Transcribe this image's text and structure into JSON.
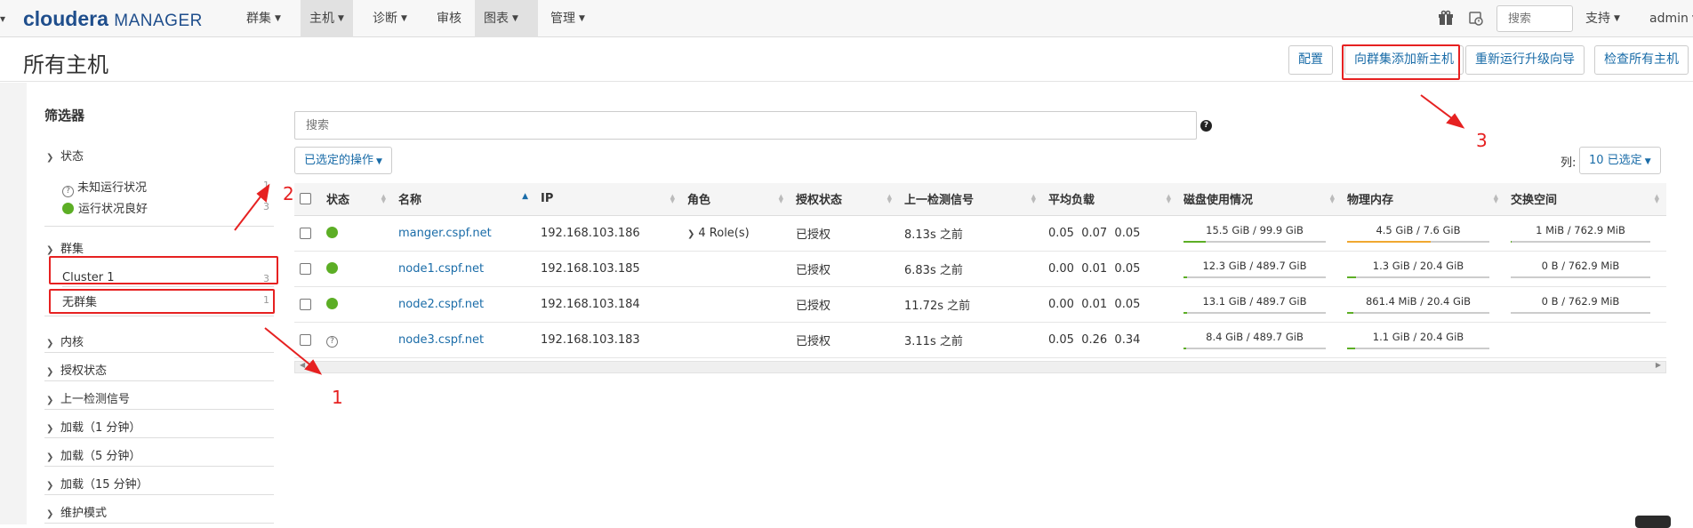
{
  "nav": {
    "edge_mark": "▾",
    "logo_brand": "cloudera",
    "logo_product": "MANAGER",
    "items": [
      {
        "label": "群集",
        "caret": true,
        "active": false
      },
      {
        "label": "主机",
        "caret": true,
        "active": true
      },
      {
        "label": "诊断",
        "caret": true,
        "active": false
      },
      {
        "label": "审核",
        "caret": false,
        "active": false
      },
      {
        "label": "图表",
        "caret": true,
        "active": true
      },
      {
        "label": "管理",
        "caret": true,
        "active": false
      }
    ],
    "gift_icon": "gift-icon",
    "activity_icon": "activity-icon",
    "search_placeholder": "搜索",
    "support_label": "支持",
    "user_label": "admin"
  },
  "header": {
    "title": "所有主机",
    "buttons": {
      "configure": "配置",
      "add_hosts": "向群集添加新主机",
      "rerun_upgrade": "重新运行升级向导",
      "inspect_all": "检查所有主机"
    }
  },
  "filters": {
    "title": "筛选器",
    "status_section": "状态",
    "status_items": [
      {
        "label": "未知运行状况",
        "count": "1",
        "icon": "unknown-health-icon"
      },
      {
        "label": "运行状况良好",
        "count": "3",
        "icon": "good-health-icon"
      }
    ],
    "cluster_section": "群集",
    "cluster_items": [
      {
        "label": "Cluster 1",
        "count": "3"
      },
      {
        "label": "无群集",
        "count": "1"
      }
    ],
    "collapsed_sections": [
      "内核",
      "授权状态",
      "上一检测信号",
      "加载（1 分钟）",
      "加载（5 分钟）",
      "加载（15 分钟）",
      "维护模式"
    ]
  },
  "toolbar": {
    "search_placeholder": "搜索",
    "actions_label": "已选定的操作",
    "columns_label": "列:",
    "columns_selected": "10 已选定"
  },
  "table": {
    "columns": [
      "状态",
      "名称",
      "IP",
      "角色",
      "授权状态",
      "上一检测信号",
      "平均负载",
      "磁盘使用情况",
      "物理内存",
      "交换空间"
    ],
    "rows": [
      {
        "status": "good",
        "name": "manger.cspf.net",
        "ip": "192.168.103.186",
        "roles": "4 Role(s)",
        "auth": "已授权",
        "heartbeat": "8.13s 之前",
        "load": "0.05  0.07  0.05",
        "disk": "15.5 GiB / 99.9 GiB",
        "disk_fraction": 0.155,
        "disk_color": "#5cae25",
        "mem": "4.5 GiB / 7.6 GiB",
        "mem_fraction": 0.59,
        "mem_color": "#f0a830",
        "swap": "1 MiB / 762.9 MiB",
        "swap_fraction": 0.002,
        "swap_color": "#5cae25"
      },
      {
        "status": "good",
        "name": "node1.cspf.net",
        "ip": "192.168.103.185",
        "roles": "",
        "auth": "已授权",
        "heartbeat": "6.83s 之前",
        "load": "0.00  0.01  0.05",
        "disk": "12.3 GiB / 489.7 GiB",
        "disk_fraction": 0.025,
        "disk_color": "#5cae25",
        "mem": "1.3 GiB / 20.4 GiB",
        "mem_fraction": 0.064,
        "mem_color": "#5cae25",
        "swap": "0 B / 762.9 MiB",
        "swap_fraction": 0.0,
        "swap_color": "#5cae25"
      },
      {
        "status": "good",
        "name": "node2.cspf.net",
        "ip": "192.168.103.184",
        "roles": "",
        "auth": "已授权",
        "heartbeat": "11.72s 之前",
        "load": "0.00  0.01  0.05",
        "disk": "13.1 GiB / 489.7 GiB",
        "disk_fraction": 0.027,
        "disk_color": "#5cae25",
        "mem": "861.4 MiB / 20.4 GiB",
        "mem_fraction": 0.041,
        "mem_color": "#5cae25",
        "swap": "0 B / 762.9 MiB",
        "swap_fraction": 0.0,
        "swap_color": "#5cae25"
      },
      {
        "status": "unknown",
        "name": "node3.cspf.net",
        "ip": "192.168.103.183",
        "roles": "",
        "auth": "已授权",
        "heartbeat": "3.11s 之前",
        "load": "0.05  0.26  0.34",
        "disk": "8.4 GiB / 489.7 GiB",
        "disk_fraction": 0.017,
        "disk_color": "#5cae25",
        "mem": "1.1 GiB / 20.4 GiB",
        "mem_fraction": 0.054,
        "mem_color": "#5cae25",
        "swap": "",
        "swap_fraction": null,
        "swap_color": "#5cae25"
      }
    ]
  },
  "annotations": {
    "label_1": "1",
    "label_2": "2",
    "label_3": "3",
    "color": "#e62121"
  }
}
